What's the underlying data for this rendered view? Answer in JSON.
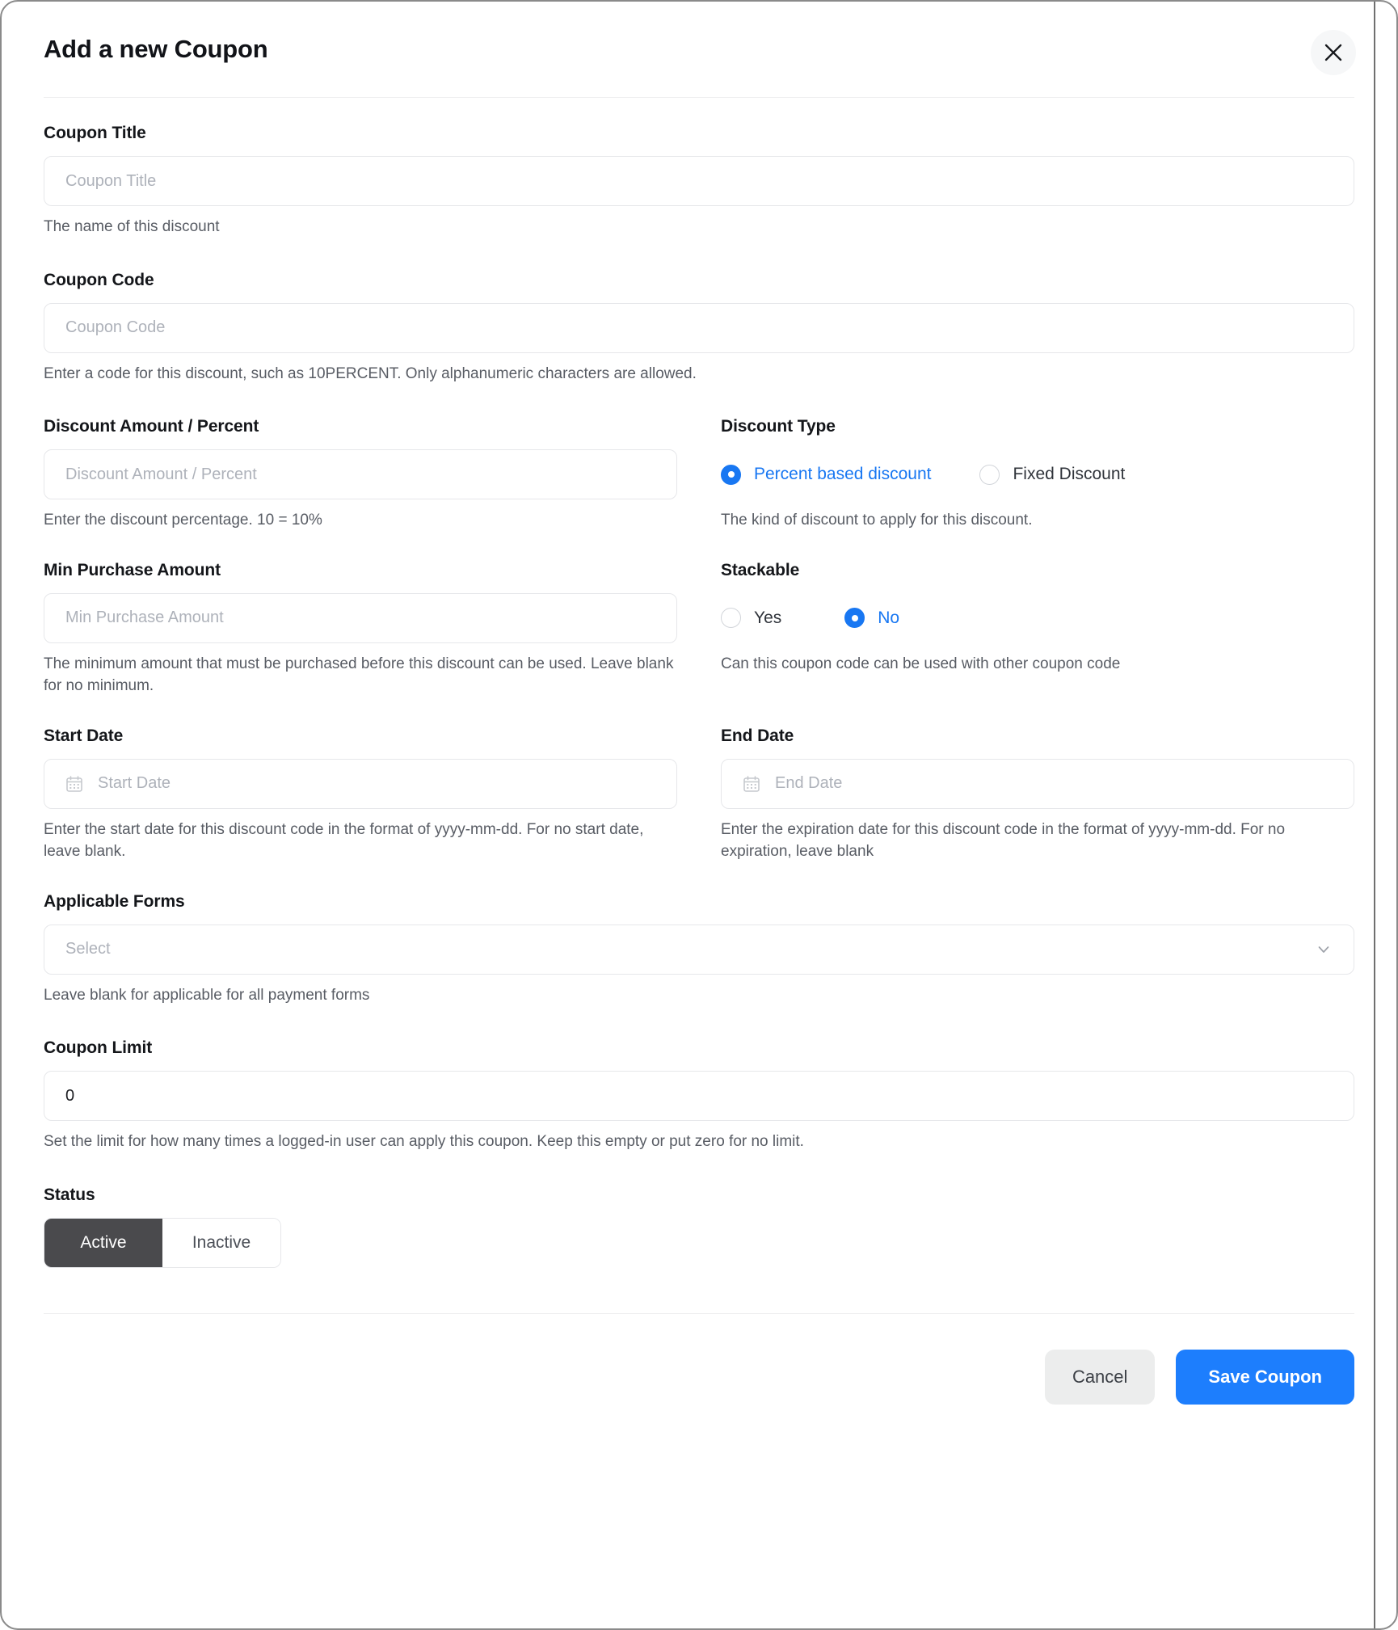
{
  "modal": {
    "title": "Add a new Coupon",
    "close_icon": "close-icon"
  },
  "fields": {
    "coupon_title": {
      "label": "Coupon Title",
      "placeholder": "Coupon Title",
      "value": "",
      "help": "The name of this discount"
    },
    "coupon_code": {
      "label": "Coupon Code",
      "placeholder": "Coupon Code",
      "value": "",
      "help": "Enter a code for this discount, such as 10PERCENT. Only alphanumeric characters are allowed."
    },
    "discount_amount": {
      "label": "Discount Amount / Percent",
      "placeholder": "Discount Amount / Percent",
      "value": "",
      "help": "Enter the discount percentage. 10 = 10%"
    },
    "discount_type": {
      "label": "Discount Type",
      "help": "The kind of discount to apply for this discount.",
      "options": [
        {
          "label": "Percent based discount",
          "selected": true
        },
        {
          "label": "Fixed Discount",
          "selected": false
        }
      ]
    },
    "min_purchase": {
      "label": "Min Purchase Amount",
      "placeholder": "Min Purchase Amount",
      "value": "",
      "help": "The minimum amount that must be purchased before this discount can be used. Leave blank for no minimum."
    },
    "stackable": {
      "label": "Stackable",
      "help": "Can this coupon code can be used with other coupon code",
      "options": [
        {
          "label": "Yes",
          "selected": false
        },
        {
          "label": "No",
          "selected": true
        }
      ]
    },
    "start_date": {
      "label": "Start Date",
      "placeholder": "Start Date",
      "value": "",
      "icon": "calendar-icon",
      "help": "Enter the start date for this discount code in the format of yyyy-mm-dd. For no start date, leave blank."
    },
    "end_date": {
      "label": "End Date",
      "placeholder": "End Date",
      "value": "",
      "icon": "calendar-icon",
      "help": "Enter the expiration date for this discount code in the format of yyyy-mm-dd. For no expiration, leave blank"
    },
    "applicable_forms": {
      "label": "Applicable Forms",
      "placeholder": "Select",
      "value": "",
      "icon": "chevron-down-icon",
      "help": "Leave blank for applicable for all payment forms"
    },
    "coupon_limit": {
      "label": "Coupon Limit",
      "placeholder": "0",
      "value": "0",
      "help": "Set the limit for how many times a logged-in user can apply this coupon. Keep this empty or put zero for no limit."
    },
    "status": {
      "label": "Status",
      "options": [
        {
          "label": "Active",
          "selected": true
        },
        {
          "label": "Inactive",
          "selected": false
        }
      ]
    }
  },
  "footer": {
    "cancel_label": "Cancel",
    "save_label": "Save Coupon"
  },
  "colors": {
    "accent_blue": "#1877f2",
    "primary_button": "#1d7efd",
    "active_segment": "#4a4a4d",
    "placeholder": "#aeb2ba",
    "help_text": "#585c64",
    "border": "#e6e7ea"
  }
}
